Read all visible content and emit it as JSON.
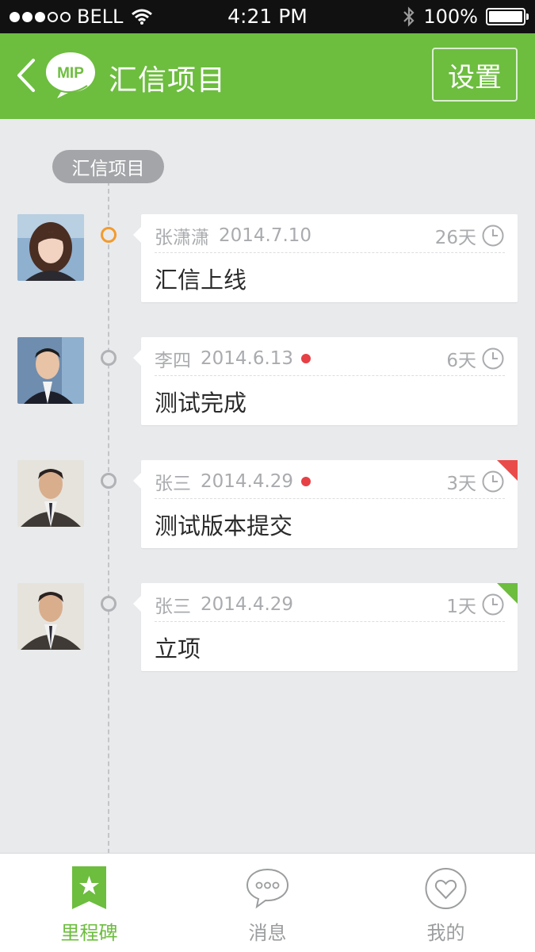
{
  "status_bar": {
    "carrier": "BELL",
    "time": "4:21 PM",
    "battery": "100%"
  },
  "nav": {
    "logo_text": "MIP",
    "title": "汇信项目",
    "settings_label": "设置"
  },
  "timeline": {
    "project_tag": "汇信项目",
    "entries": [
      {
        "author": "张潇潇",
        "date": "2014.7.10",
        "flag": false,
        "days": "26天",
        "text": "汇信上线",
        "active": true,
        "corner": "",
        "avatar": "avatar-woman"
      },
      {
        "author": "李四",
        "date": "2014.6.13",
        "flag": true,
        "days": "6天",
        "text": "测试完成",
        "active": false,
        "corner": "",
        "avatar": "avatar-young-man"
      },
      {
        "author": "张三",
        "date": "2014.4.29",
        "flag": true,
        "days": "3天",
        "text": "测试版本提交",
        "active": false,
        "corner": "#e94b4b",
        "avatar": "avatar-man"
      },
      {
        "author": "张三",
        "date": "2014.4.29",
        "flag": false,
        "days": "1天",
        "text": "立项",
        "active": false,
        "corner": "#6dbd3f",
        "avatar": "avatar-man"
      }
    ]
  },
  "tabbar": {
    "tabs": [
      {
        "label": "里程碑",
        "icon": "milestone-star-icon",
        "active": true
      },
      {
        "label": "消息",
        "icon": "message-bubble-icon",
        "active": false
      },
      {
        "label": "我的",
        "icon": "heart-profile-icon",
        "active": false
      }
    ]
  },
  "colors": {
    "brand_green": "#6dbd3f",
    "active_orange": "#f39b2d",
    "flag_red": "#e64045"
  }
}
